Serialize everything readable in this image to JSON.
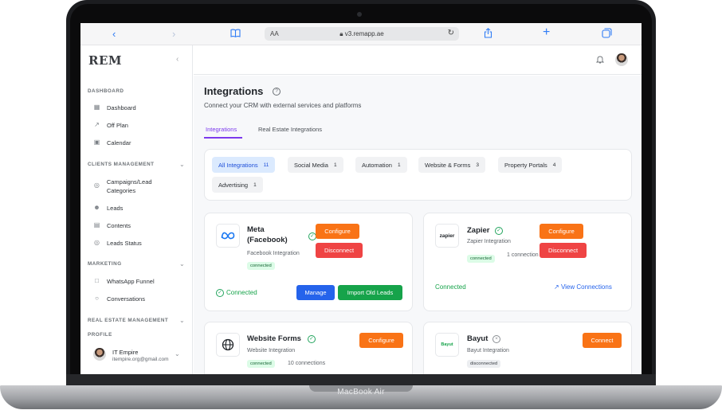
{
  "device": {
    "model_label": "MacBook Air"
  },
  "browser": {
    "text_size": "AA",
    "url": "v3.remapp.ae"
  },
  "sidebar": {
    "logo": "REM",
    "sections": {
      "dashboard": "DASHBOARD",
      "clients": "CLIENTS MANAGEMENT",
      "marketing": "MARKETING",
      "real_estate": "REAL ESTATE MANAGEMENT"
    },
    "items": {
      "dashboard": "Dashboard",
      "off_plan": "Off Plan",
      "calendar": "Calendar",
      "campaigns": "Campaigns/Lead Categories",
      "leads": "Leads",
      "contents": "Contents",
      "leads_status": "Leads Status",
      "whatsapp_funnel": "WhatsApp Funnel",
      "conversations": "Conversations"
    },
    "profile": {
      "label": "PROFILE",
      "name": "IT Empire",
      "email": "itempire.org@gmail.com"
    }
  },
  "page": {
    "title": "Integrations",
    "subtitle": "Connect your CRM with external services and platforms",
    "tabs": [
      "Integrations",
      "Real Estate Integrations"
    ]
  },
  "filters": [
    {
      "label": "All Integrations",
      "count": "11"
    },
    {
      "label": "Social Media",
      "count": "1"
    },
    {
      "label": "Automation",
      "count": "1"
    },
    {
      "label": "Website & Forms",
      "count": "3"
    },
    {
      "label": "Property Portals",
      "count": "4"
    },
    {
      "label": "Advertising",
      "count": "1"
    }
  ],
  "cards": {
    "meta": {
      "title": "Meta (Facebook)",
      "desc": "Facebook Integration",
      "badge": "connected",
      "configure": "Configure",
      "disconnect": "Disconnect",
      "status": "Connected",
      "manage": "Manage",
      "import": "Import Old Leads"
    },
    "zapier": {
      "logo": "zapier",
      "title": "Zapier",
      "desc": "Zapier Integration",
      "badge": "connected",
      "connections": "1 connection",
      "configure": "Configure",
      "disconnect": "Disconnect",
      "status": "Connected",
      "view": "View Connections"
    },
    "forms": {
      "title": "Website Forms",
      "desc": "Website Integration",
      "badge": "connected",
      "connections": "10 connections",
      "configure": "Configure"
    },
    "bayut": {
      "logo": "Bayut",
      "title": "Bayut",
      "desc": "Bayut Integration",
      "badge": "disconnected",
      "connect": "Connect"
    }
  },
  "colors": {
    "accent": "#7c3aed",
    "orange": "#f97316",
    "red": "#ef4444",
    "blue": "#2563eb",
    "green": "#16a34a"
  }
}
